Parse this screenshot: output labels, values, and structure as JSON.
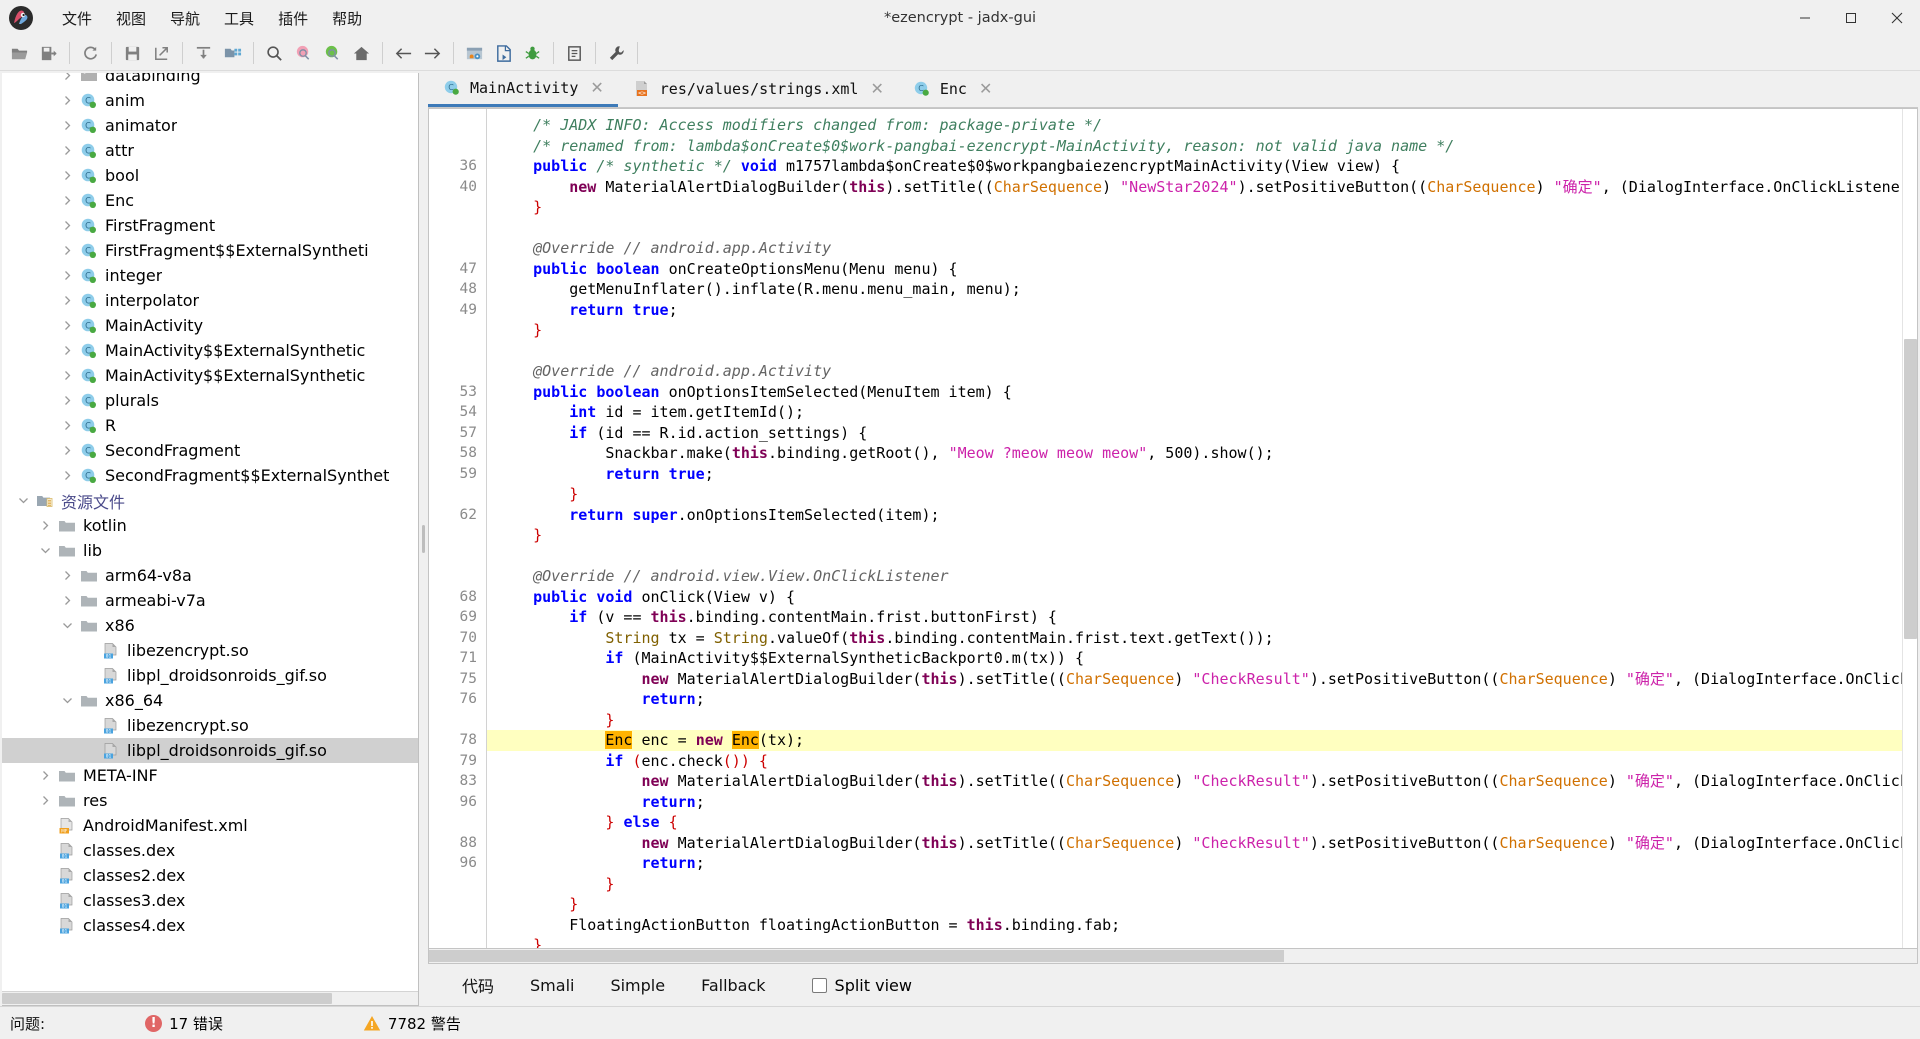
{
  "window": {
    "title": "*ezencrypt - jadx-gui",
    "minimize": "–",
    "maximize": "❐",
    "close": "✕"
  },
  "menubar": {
    "items": [
      {
        "label": "文件",
        "name": "menu-file"
      },
      {
        "label": "视图",
        "name": "menu-view"
      },
      {
        "label": "导航",
        "name": "menu-navigation"
      },
      {
        "label": "工具",
        "name": "menu-tools"
      },
      {
        "label": "插件",
        "name": "menu-plugins"
      },
      {
        "label": "帮助",
        "name": "menu-help"
      }
    ]
  },
  "toolbar": {
    "buttons": [
      "open-folder-icon",
      "save-all-icon",
      "sep",
      "reload-icon",
      "sep",
      "save-icon",
      "export-icon",
      "sep",
      "sync-icon",
      "flatten-packages-icon",
      "sep",
      "search-icon",
      "search-class-icon",
      "search-comment-icon",
      "home-icon",
      "sep",
      "back-arrow-icon",
      "forward-arrow-icon",
      "sep",
      "deobfuscation-icon",
      "decompile-icon",
      "debugger-icon",
      "sep",
      "log-icon",
      "sep",
      "preferences-icon"
    ]
  },
  "tree": {
    "items": [
      {
        "label": "databinding",
        "icon": "package-folder-icon",
        "indent": 2,
        "arrow": "right",
        "selected": false
      },
      {
        "label": "anim",
        "icon": "class-icon",
        "indent": 2,
        "arrow": "right",
        "selected": false
      },
      {
        "label": "animator",
        "icon": "class-icon",
        "indent": 2,
        "arrow": "right",
        "selected": false
      },
      {
        "label": "attr",
        "icon": "class-icon",
        "indent": 2,
        "arrow": "right",
        "selected": false
      },
      {
        "label": "bool",
        "icon": "class-icon",
        "indent": 2,
        "arrow": "right",
        "selected": false
      },
      {
        "label": "Enc",
        "icon": "class-icon",
        "indent": 2,
        "arrow": "right",
        "selected": false
      },
      {
        "label": "FirstFragment",
        "icon": "class-icon",
        "indent": 2,
        "arrow": "right",
        "selected": false
      },
      {
        "label": "FirstFragment$$ExternalSyntheti",
        "icon": "class-icon",
        "indent": 2,
        "arrow": "right",
        "selected": false
      },
      {
        "label": "integer",
        "icon": "class-icon",
        "indent": 2,
        "arrow": "right",
        "selected": false
      },
      {
        "label": "interpolator",
        "icon": "class-icon",
        "indent": 2,
        "arrow": "right",
        "selected": false
      },
      {
        "label": "MainActivity",
        "icon": "class-icon",
        "indent": 2,
        "arrow": "right",
        "selected": false
      },
      {
        "label": "MainActivity$$ExternalSynthetic",
        "icon": "class-icon",
        "indent": 2,
        "arrow": "right",
        "selected": false
      },
      {
        "label": "MainActivity$$ExternalSynthetic",
        "icon": "class-icon",
        "indent": 2,
        "arrow": "right",
        "selected": false
      },
      {
        "label": "plurals",
        "icon": "class-icon",
        "indent": 2,
        "arrow": "right",
        "selected": false
      },
      {
        "label": "R",
        "icon": "class-icon",
        "indent": 2,
        "arrow": "right",
        "selected": false
      },
      {
        "label": "SecondFragment",
        "icon": "class-icon",
        "indent": 2,
        "arrow": "right",
        "selected": false
      },
      {
        "label": "SecondFragment$$ExternalSynthet",
        "icon": "class-icon",
        "indent": 2,
        "arrow": "right",
        "selected": false
      },
      {
        "label": "资源文件",
        "icon": "resources-folder-icon",
        "indent": 0,
        "arrow": "down",
        "selected": false,
        "root": true
      },
      {
        "label": "kotlin",
        "icon": "folder-icon",
        "indent": 1,
        "arrow": "right",
        "selected": false
      },
      {
        "label": "lib",
        "icon": "folder-icon",
        "indent": 1,
        "arrow": "down",
        "selected": false
      },
      {
        "label": "arm64-v8a",
        "icon": "folder-icon",
        "indent": 2,
        "arrow": "right",
        "selected": false
      },
      {
        "label": "armeabi-v7a",
        "icon": "folder-icon",
        "indent": 2,
        "arrow": "right",
        "selected": false
      },
      {
        "label": "x86",
        "icon": "folder-icon",
        "indent": 2,
        "arrow": "down",
        "selected": false
      },
      {
        "label": "libezencrypt.so",
        "icon": "binary-file-icon",
        "indent": 3,
        "arrow": "none",
        "selected": false
      },
      {
        "label": "libpl_droidsonroids_gif.so",
        "icon": "binary-file-icon",
        "indent": 3,
        "arrow": "none",
        "selected": false
      },
      {
        "label": "x86_64",
        "icon": "folder-icon",
        "indent": 2,
        "arrow": "down",
        "selected": false
      },
      {
        "label": "libezencrypt.so",
        "icon": "binary-file-icon",
        "indent": 3,
        "arrow": "none",
        "selected": false
      },
      {
        "label": "libpl_droidsonroids_gif.so",
        "icon": "binary-file-icon",
        "indent": 3,
        "arrow": "none",
        "selected": true
      },
      {
        "label": "META-INF",
        "icon": "folder-icon",
        "indent": 1,
        "arrow": "right",
        "selected": false
      },
      {
        "label": "res",
        "icon": "folder-icon",
        "indent": 1,
        "arrow": "right",
        "selected": false
      },
      {
        "label": "AndroidManifest.xml",
        "icon": "manifest-icon",
        "indent": 1,
        "arrow": "none",
        "selected": false
      },
      {
        "label": "classes.dex",
        "icon": "dex-file-icon",
        "indent": 1,
        "arrow": "none",
        "selected": false
      },
      {
        "label": "classes2.dex",
        "icon": "dex-file-icon",
        "indent": 1,
        "arrow": "none",
        "selected": false
      },
      {
        "label": "classes3.dex",
        "icon": "dex-file-icon",
        "indent": 1,
        "arrow": "none",
        "selected": false
      },
      {
        "label": "classes4.dex",
        "icon": "dex-file-icon",
        "indent": 1,
        "arrow": "none",
        "selected": false
      }
    ]
  },
  "editor": {
    "tabs": [
      {
        "label": "MainActivity",
        "icon": "class-icon",
        "active": true,
        "close": "✕"
      },
      {
        "label": "res/values/strings.xml",
        "icon": "xml-file-icon",
        "active": false,
        "close": "✕"
      },
      {
        "label": "Enc",
        "icon": "class-icon",
        "active": false,
        "close": "✕"
      }
    ],
    "line_numbers": [
      "",
      "",
      "36",
      "40",
      "",
      "",
      "",
      "47",
      "48",
      "49",
      "",
      "",
      "",
      "53",
      "54",
      "57",
      "58",
      "59",
      "",
      "62",
      "",
      "",
      "",
      "68",
      "69",
      "70",
      "71",
      "75",
      "76",
      "",
      "78",
      "79",
      "83",
      "96",
      "",
      "88",
      "96",
      "",
      "",
      "",
      "",
      "",
      ""
    ],
    "highlighted_line": "78",
    "highlight_words": [
      "Enc"
    ]
  },
  "viewbar": {
    "tabs": [
      "代码",
      "Smali",
      "Simple",
      "Fallback"
    ],
    "active_tab": "代码",
    "split_view_label": "Split view",
    "split_view_checked": false
  },
  "statusbar": {
    "label": "问题:",
    "errors": "17 错误",
    "warnings": "7782 警告",
    "error_icon": "error-circle-icon",
    "warning_icon": "warning-triangle-icon"
  },
  "colors": {
    "accent": "#3d7ab8",
    "highlight_line": "#ffffc0",
    "highlight_word": "#ffb300",
    "selection": "#d0d0d0",
    "error": "#e06666",
    "warning": "#f5a623"
  }
}
